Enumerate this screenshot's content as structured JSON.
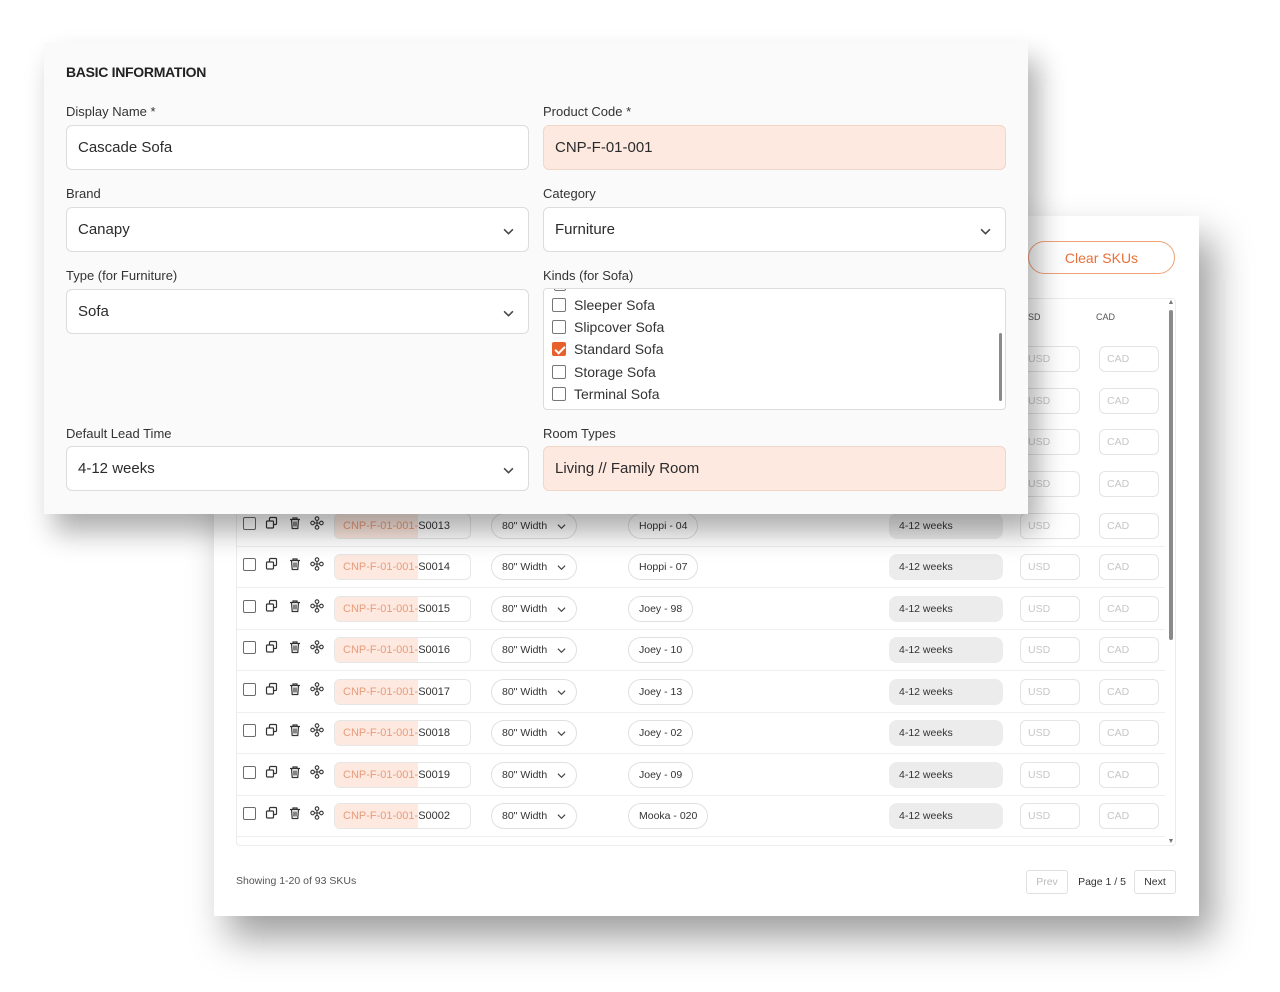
{
  "basic_info": {
    "section_title": "BASIC INFORMATION",
    "display_name": {
      "label": "Display Name *",
      "value": "Cascade Sofa"
    },
    "product_code": {
      "label": "Product Code *",
      "value": "CNP-F-01-001"
    },
    "brand": {
      "label": "Brand",
      "value": "Canapy"
    },
    "category": {
      "label": "Category",
      "value": "Furniture"
    },
    "type": {
      "label": "Type (for Furniture)",
      "value": "Sofa"
    },
    "kinds": {
      "label": "Kinds (for Sofa)",
      "options": [
        {
          "label": "Sleeper Sofa",
          "checked": false
        },
        {
          "label": "Slipcover Sofa",
          "checked": false
        },
        {
          "label": "Standard Sofa",
          "checked": true
        },
        {
          "label": "Storage Sofa",
          "checked": false
        },
        {
          "label": "Terminal Sofa",
          "checked": false
        }
      ]
    },
    "default_lead_time": {
      "label": "Default Lead Time",
      "value": "4-12 weeks"
    },
    "room_types": {
      "label": "Room Types",
      "value": "Living // Family Room"
    }
  },
  "sku_panel": {
    "clear_button": "Clear SKUs",
    "columns": {
      "usd_partial": "SD",
      "cad": "CAD"
    },
    "price_placeholder_usd": "USD",
    "price_placeholder_cad": "CAD",
    "rows": [
      {
        "code_prefix": "CNP-F-01-001-",
        "code_suffix": "S0013",
        "size": "80\" Width",
        "fabric": "Hoppi - 04",
        "lead": "4-12 weeks"
      },
      {
        "code_prefix": "CNP-F-01-001-",
        "code_suffix": "S0014",
        "size": "80\" Width",
        "fabric": "Hoppi - 07",
        "lead": "4-12 weeks"
      },
      {
        "code_prefix": "CNP-F-01-001-",
        "code_suffix": "S0015",
        "size": "80\" Width",
        "fabric": "Joey - 98",
        "lead": "4-12 weeks"
      },
      {
        "code_prefix": "CNP-F-01-001-",
        "code_suffix": "S0016",
        "size": "80\" Width",
        "fabric": "Joey - 10",
        "lead": "4-12 weeks"
      },
      {
        "code_prefix": "CNP-F-01-001-",
        "code_suffix": "S0017",
        "size": "80\" Width",
        "fabric": "Joey - 13",
        "lead": "4-12 weeks"
      },
      {
        "code_prefix": "CNP-F-01-001-",
        "code_suffix": "S0018",
        "size": "80\" Width",
        "fabric": "Joey - 02",
        "lead": "4-12 weeks"
      },
      {
        "code_prefix": "CNP-F-01-001-",
        "code_suffix": "S0019",
        "size": "80\" Width",
        "fabric": "Joey - 09",
        "lead": "4-12 weeks"
      },
      {
        "code_prefix": "CNP-F-01-001-",
        "code_suffix": "S0002",
        "size": "80\" Width",
        "fabric": "Mooka - 020",
        "lead": "4-12 weeks"
      }
    ],
    "footer": {
      "showing": "Showing 1-20 of 93 SKUs",
      "prev": "Prev",
      "page": "Page 1 / 5",
      "next": "Next"
    }
  },
  "colors": {
    "accent": "#e8612c",
    "readonly_bg": "#fde9e0"
  }
}
